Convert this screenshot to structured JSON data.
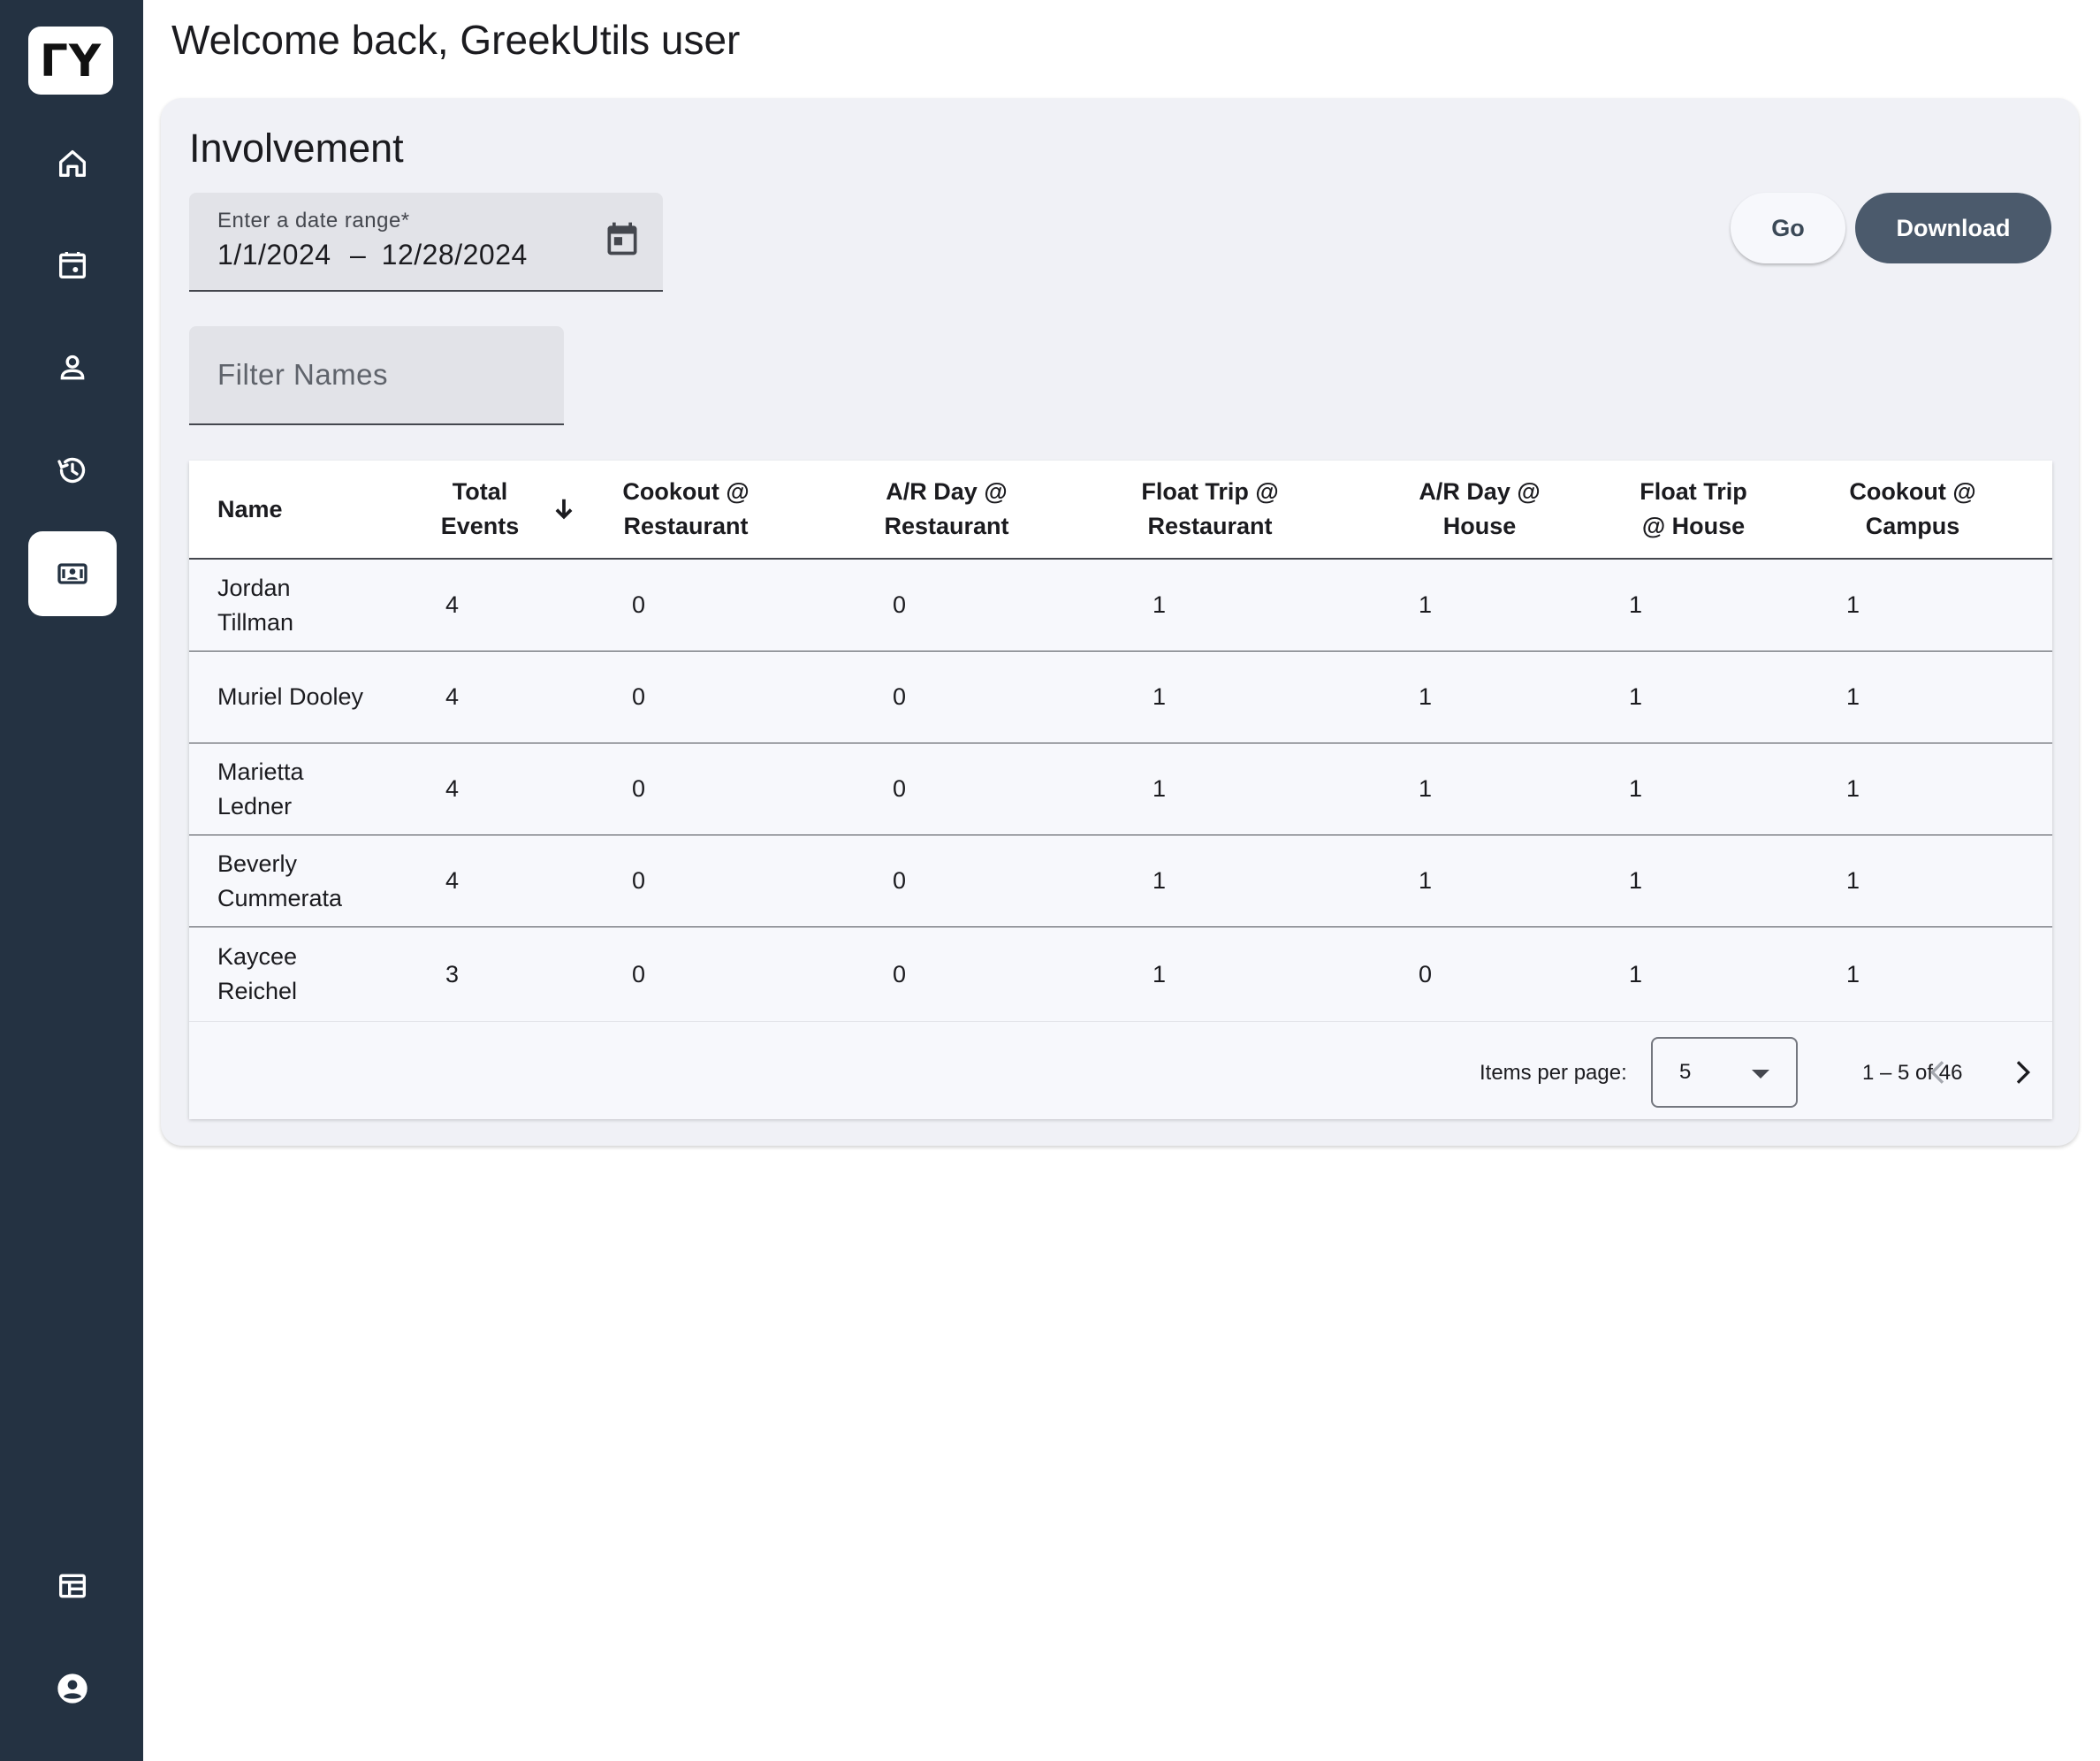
{
  "app": {
    "logo_text": "ΓY"
  },
  "colors": {
    "sidebar": "#243242",
    "card_bg": "#f0f1f6",
    "primary_button": "#4b5a6c"
  },
  "sidebar": {
    "items": [
      {
        "name": "home",
        "icon": "home-icon",
        "active": false
      },
      {
        "name": "events",
        "icon": "calendar-event-icon",
        "active": false
      },
      {
        "name": "profile",
        "icon": "person-icon",
        "active": false
      },
      {
        "name": "history",
        "icon": "history-icon",
        "active": false
      },
      {
        "name": "involvement",
        "icon": "badge-id-icon",
        "active": true
      },
      {
        "name": "table-view",
        "icon": "table-chart-icon",
        "active": false
      },
      {
        "name": "account",
        "icon": "account-circle-icon",
        "active": false
      }
    ]
  },
  "header": {
    "welcome": "Welcome back, GreekUtils user"
  },
  "card": {
    "title": "Involvement"
  },
  "date_range": {
    "label": "Enter a date range*",
    "start": "1/1/2024",
    "separator": "–",
    "end": "12/28/2024"
  },
  "actions": {
    "go_label": "Go",
    "download_label": "Download"
  },
  "filter": {
    "placeholder": "Filter Names",
    "value": ""
  },
  "table": {
    "sort": {
      "column": "Total Events",
      "direction": "descending"
    },
    "columns": [
      [
        "Name"
      ],
      [
        "Total",
        "Events"
      ],
      [
        "Cookout @",
        "Restaurant"
      ],
      [
        "A/R Day @",
        "Restaurant"
      ],
      [
        "Float Trip @",
        "Restaurant"
      ],
      [
        "A/R Day @",
        "House"
      ],
      [
        "Float Trip",
        "@ House"
      ],
      [
        "Cookout @",
        "Campus"
      ]
    ],
    "rows": [
      {
        "name": [
          "Jordan",
          "Tillman"
        ],
        "values": [
          "4",
          "0",
          "0",
          "1",
          "1",
          "1",
          "1"
        ]
      },
      {
        "name": [
          "Muriel Dooley"
        ],
        "values": [
          "4",
          "0",
          "0",
          "1",
          "1",
          "1",
          "1"
        ]
      },
      {
        "name": [
          "Marietta",
          "Ledner"
        ],
        "values": [
          "4",
          "0",
          "0",
          "1",
          "1",
          "1",
          "1"
        ]
      },
      {
        "name": [
          "Beverly",
          "Cummerata"
        ],
        "values": [
          "4",
          "0",
          "0",
          "1",
          "1",
          "1",
          "1"
        ]
      },
      {
        "name": [
          "Kaycee",
          "Reichel"
        ],
        "values": [
          "3",
          "0",
          "0",
          "1",
          "0",
          "1",
          "1"
        ]
      }
    ]
  },
  "paginator": {
    "items_per_page_label": "Items per page:",
    "page_size": "5",
    "range": "1 – 5 of 46"
  }
}
